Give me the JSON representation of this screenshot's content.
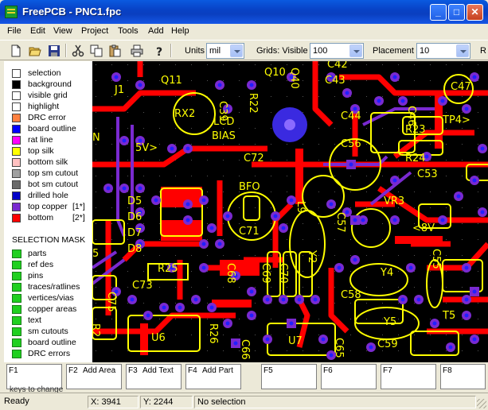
{
  "window": {
    "title": "FreePCB - PNC1.fpc",
    "minimize": "_",
    "maximize": "□",
    "close": "✕"
  },
  "menu": [
    "File",
    "Edit",
    "View",
    "Project",
    "Tools",
    "Add",
    "Help"
  ],
  "toolbar": {
    "units_label": "Units",
    "units_value": "mil",
    "grids_label": "Grids: Visible",
    "grids_value": "100",
    "placement_label": "Placement",
    "placement_value": "10",
    "cut_label": "R"
  },
  "layers": [
    {
      "label": "selection",
      "color": "#ffffff"
    },
    {
      "label": "background",
      "color": "#000000"
    },
    {
      "label": "visible grid",
      "color": "#ffffff"
    },
    {
      "label": "highlight",
      "color": "#ffffff"
    },
    {
      "label": "DRC error",
      "color": "#ff8040"
    },
    {
      "label": "board outline",
      "color": "#0000ff"
    },
    {
      "label": "rat line",
      "color": "#ff00ff"
    },
    {
      "label": "top silk",
      "color": "#ffff00"
    },
    {
      "label": "bottom silk",
      "color": "#ffc0c0"
    },
    {
      "label": "top sm cutout",
      "color": "#a0a0a0"
    },
    {
      "label": "bot sm cutout",
      "color": "#6a6a6a"
    },
    {
      "label": "drilled hole",
      "color": "#0000c8"
    },
    {
      "label": "top copper",
      "key": "[1*]",
      "color": "#7a2ad0",
      "active": true
    },
    {
      "label": "bottom",
      "key": "[2*]",
      "color": "#ff0000"
    }
  ],
  "mask": {
    "title": "SELECTION MASK",
    "items": [
      "parts",
      "ref des",
      "pins",
      "traces/ratlines",
      "vertices/vias",
      "copper areas",
      "text",
      "sm cutouts",
      "board outline",
      "DRC errors"
    ]
  },
  "pcb": {
    "silk_labels": [
      "Q11",
      "R22",
      "Q10",
      "Q40",
      "C42",
      "C43",
      "C47",
      "J1",
      "RX2",
      "C39",
      "LCD",
      "BIAS",
      "C44",
      "C46",
      "R23",
      "TP4>",
      "N",
      "5V>",
      "C56",
      "R24",
      "C72",
      "C53",
      "BFO",
      "L9",
      "VR3",
      "D5",
      "D6",
      "D7",
      "D8",
      "C71",
      "C57",
      "<8V",
      "5",
      "R25",
      "C55",
      "Y2",
      "C68",
      "C69",
      "C70",
      "Y4",
      "C73",
      "C75",
      "C58",
      "R26",
      "U6",
      "Y5",
      "T5",
      "R2",
      "C66",
      "U7",
      "C59",
      "C65"
    ]
  },
  "fkeys": [
    {
      "num": "F1",
      "label": ""
    },
    {
      "num": "F2",
      "label": "Add Area"
    },
    {
      "num": "F3",
      "label": "Add Text"
    },
    {
      "num": "F4",
      "label": "Add Part"
    },
    {
      "num": "F5",
      "label": ""
    },
    {
      "num": "F6",
      "label": ""
    },
    {
      "num": "F7",
      "label": ""
    },
    {
      "num": "F8",
      "label": ""
    }
  ],
  "hint": "keys to change",
  "status": {
    "ready": "Ready",
    "x": "X: 3941",
    "y": "Y: 2244",
    "selection": "No selection"
  }
}
